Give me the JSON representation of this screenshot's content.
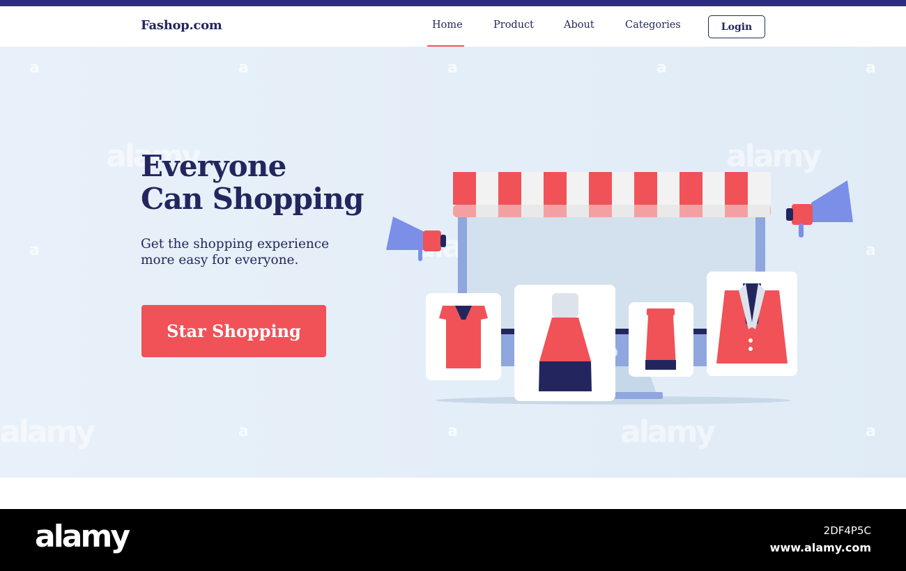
{
  "navbar": {
    "brand": "Fashop.com",
    "links": [
      "Home",
      "Product",
      "About",
      "Categories"
    ],
    "active_link": "Home",
    "login_label": "Login"
  },
  "hero": {
    "title_line1": "Everyone",
    "title_line2": "Can Shopping",
    "subtitle_line1": "Get the shopping experience",
    "subtitle_line2": "more easy for everyone.",
    "cta_label": "Star Shopping"
  },
  "watermark": {
    "logo_text": "alamy",
    "mark": "a",
    "image_id": "2DF4P5C",
    "url": "www.alamy.com"
  },
  "colors": {
    "navy": "#23265e",
    "accent_red": "#f05258",
    "monitor_blue": "#8fa6de",
    "hero_bg": "#e6f0f8"
  },
  "illustration": {
    "icons": [
      "monitor-icon",
      "awning-icon",
      "megaphone-icon",
      "blouse-icon",
      "dress-icon",
      "skirt-icon",
      "blazer-icon"
    ]
  }
}
